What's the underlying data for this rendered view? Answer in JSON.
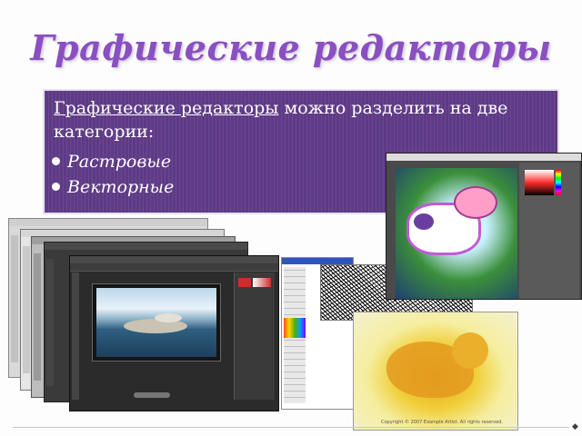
{
  "slide": {
    "title": "Графические редакторы",
    "intro_link": "Графические редакторы",
    "intro_rest": " можно разделить на две категории:",
    "bullets": [
      "Растровые",
      "Векторные"
    ]
  },
  "colors": {
    "title": "#8a4fc0",
    "panel": "#5f3a86",
    "panel_text": "#ffffff"
  },
  "screenshots": {
    "elephant_credit": "Copyright © 2007 Example Artist. All rights reserved."
  },
  "footer_marker": "◆"
}
